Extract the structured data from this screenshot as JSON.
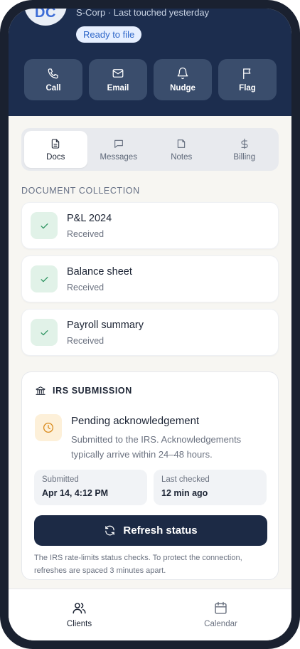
{
  "header": {
    "avatar_initials": "DC",
    "subtitle": "S-Corp · Last touched yesterday",
    "status_pill": "Ready to file",
    "actions": [
      {
        "label": "Call",
        "icon": "phone-icon"
      },
      {
        "label": "Email",
        "icon": "mail-icon"
      },
      {
        "label": "Nudge",
        "icon": "bell-icon"
      },
      {
        "label": "Flag",
        "icon": "flag-icon"
      }
    ]
  },
  "tabs": [
    {
      "label": "Docs",
      "icon": "document-icon",
      "active": true
    },
    {
      "label": "Messages",
      "icon": "message-icon",
      "active": false
    },
    {
      "label": "Notes",
      "icon": "note-icon",
      "active": false
    },
    {
      "label": "Billing",
      "icon": "dollar-icon",
      "active": false
    }
  ],
  "documents": {
    "section_title": "DOCUMENT COLLECTION",
    "items": [
      {
        "title": "P&L 2024",
        "status": "Received"
      },
      {
        "title": "Balance sheet",
        "status": "Received"
      },
      {
        "title": "Payroll summary",
        "status": "Received"
      }
    ]
  },
  "irs": {
    "heading": "IRS SUBMISSION",
    "status_title": "Pending acknowledgement",
    "status_desc": "Submitted to the IRS. Acknowledgements typically arrive within 24–48 hours.",
    "submitted_label": "Submitted",
    "submitted_value": "Apr 14, 4:12 PM",
    "checked_label": "Last checked",
    "checked_value": "12 min ago",
    "refresh_label": "Refresh status",
    "note": "The IRS rate-limits status checks. To protect the connection, refreshes are spaced 3 minutes apart."
  },
  "bottom_nav": [
    {
      "label": "Clients",
      "icon": "users-icon",
      "active": true
    },
    {
      "label": "Calendar",
      "icon": "calendar-icon",
      "active": false
    }
  ],
  "colors": {
    "header_bg": "#1c2d4e",
    "accent": "#2f67c9",
    "success": "#2e9461",
    "pending": "#d98a1c",
    "primary_button": "#1c2a45"
  }
}
